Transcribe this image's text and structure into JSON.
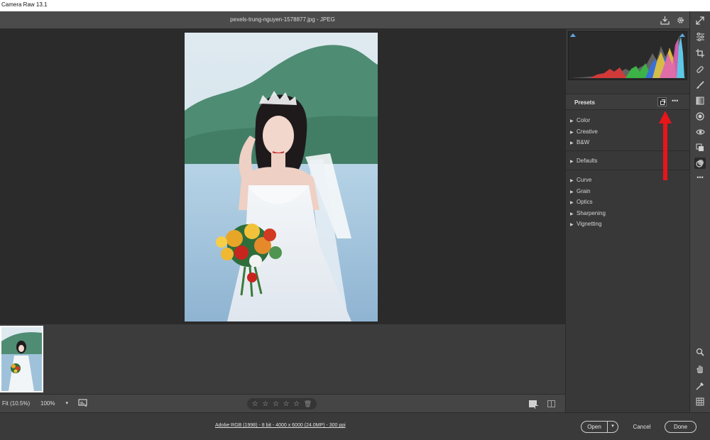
{
  "app": {
    "title": "Camera Raw 13.1"
  },
  "header": {
    "file_name": "pexels-trung-nguyen-1578877.jpg  -  JPEG",
    "icons": [
      "save-icon",
      "settings-gear-icon",
      "expand-icon"
    ]
  },
  "presets": {
    "title": "Presets",
    "groups": [
      {
        "label": "Color"
      },
      {
        "label": "Creative"
      },
      {
        "label": "B&W"
      },
      {
        "label": "Defaults"
      },
      {
        "label": "Curve"
      },
      {
        "label": "Grain"
      },
      {
        "label": "Optics"
      },
      {
        "label": "Sharpening"
      },
      {
        "label": "Vignetting"
      }
    ]
  },
  "toolstrip": {
    "tools": [
      "edit-sliders-icon",
      "crop-icon",
      "healing-brush-icon",
      "masking-brush-icon",
      "linear-gradient-icon",
      "radial-filter-icon",
      "red-eye-icon",
      "snapshots-icon",
      "presets-icon",
      "more-icon",
      "zoom-icon",
      "hand-icon",
      "white-balance-icon",
      "grid-icon"
    ],
    "active": "presets-icon"
  },
  "statusbar": {
    "fit_label": "Fit (10.5%)",
    "zoom_value": "100%",
    "rating_stars": 5,
    "rating_value": 0
  },
  "footer": {
    "info_link": "Adobe RGB (1998) - 8 bit - 4000 x 6000 (24.0MP) - 300 ppi",
    "open_label": "Open",
    "cancel_label": "Cancel",
    "done_label": "Done"
  },
  "colors": {
    "accent": "#5fa8e0",
    "arrow_annotation": "#e8151b",
    "panel_bg": "#383838",
    "canvas_bg": "#2b2b2b"
  }
}
